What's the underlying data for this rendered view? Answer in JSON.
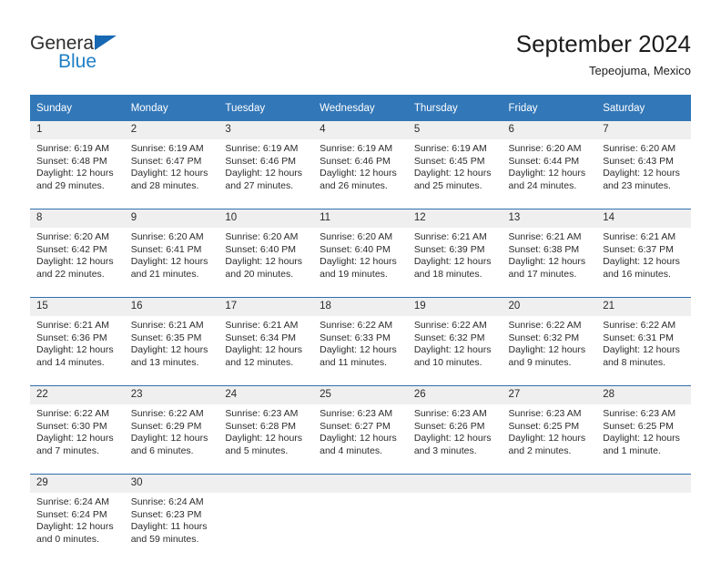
{
  "brand": {
    "name_part1": "General",
    "name_part2": "Blue",
    "accent_color": "#1f7fc6",
    "triangle_color": "#1668b3"
  },
  "header": {
    "title": "September 2024",
    "subtitle": "Tepeojuma, Mexico"
  },
  "theme": {
    "header_bg": "#3277b8",
    "day_band_bg": "#efefef",
    "separator_color": "#2f6fad"
  },
  "weekday_headers": [
    "Sunday",
    "Monday",
    "Tuesday",
    "Wednesday",
    "Thursday",
    "Friday",
    "Saturday"
  ],
  "weeks": [
    {
      "days": [
        {
          "number": "1",
          "sunrise": "Sunrise: 6:19 AM",
          "sunset": "Sunset: 6:48 PM",
          "daylight_line1": "Daylight: 12 hours",
          "daylight_line2": "and 29 minutes."
        },
        {
          "number": "2",
          "sunrise": "Sunrise: 6:19 AM",
          "sunset": "Sunset: 6:47 PM",
          "daylight_line1": "Daylight: 12 hours",
          "daylight_line2": "and 28 minutes."
        },
        {
          "number": "3",
          "sunrise": "Sunrise: 6:19 AM",
          "sunset": "Sunset: 6:46 PM",
          "daylight_line1": "Daylight: 12 hours",
          "daylight_line2": "and 27 minutes."
        },
        {
          "number": "4",
          "sunrise": "Sunrise: 6:19 AM",
          "sunset": "Sunset: 6:46 PM",
          "daylight_line1": "Daylight: 12 hours",
          "daylight_line2": "and 26 minutes."
        },
        {
          "number": "5",
          "sunrise": "Sunrise: 6:19 AM",
          "sunset": "Sunset: 6:45 PM",
          "daylight_line1": "Daylight: 12 hours",
          "daylight_line2": "and 25 minutes."
        },
        {
          "number": "6",
          "sunrise": "Sunrise: 6:20 AM",
          "sunset": "Sunset: 6:44 PM",
          "daylight_line1": "Daylight: 12 hours",
          "daylight_line2": "and 24 minutes."
        },
        {
          "number": "7",
          "sunrise": "Sunrise: 6:20 AM",
          "sunset": "Sunset: 6:43 PM",
          "daylight_line1": "Daylight: 12 hours",
          "daylight_line2": "and 23 minutes."
        }
      ]
    },
    {
      "days": [
        {
          "number": "8",
          "sunrise": "Sunrise: 6:20 AM",
          "sunset": "Sunset: 6:42 PM",
          "daylight_line1": "Daylight: 12 hours",
          "daylight_line2": "and 22 minutes."
        },
        {
          "number": "9",
          "sunrise": "Sunrise: 6:20 AM",
          "sunset": "Sunset: 6:41 PM",
          "daylight_line1": "Daylight: 12 hours",
          "daylight_line2": "and 21 minutes."
        },
        {
          "number": "10",
          "sunrise": "Sunrise: 6:20 AM",
          "sunset": "Sunset: 6:40 PM",
          "daylight_line1": "Daylight: 12 hours",
          "daylight_line2": "and 20 minutes."
        },
        {
          "number": "11",
          "sunrise": "Sunrise: 6:20 AM",
          "sunset": "Sunset: 6:40 PM",
          "daylight_line1": "Daylight: 12 hours",
          "daylight_line2": "and 19 minutes."
        },
        {
          "number": "12",
          "sunrise": "Sunrise: 6:21 AM",
          "sunset": "Sunset: 6:39 PM",
          "daylight_line1": "Daylight: 12 hours",
          "daylight_line2": "and 18 minutes."
        },
        {
          "number": "13",
          "sunrise": "Sunrise: 6:21 AM",
          "sunset": "Sunset: 6:38 PM",
          "daylight_line1": "Daylight: 12 hours",
          "daylight_line2": "and 17 minutes."
        },
        {
          "number": "14",
          "sunrise": "Sunrise: 6:21 AM",
          "sunset": "Sunset: 6:37 PM",
          "daylight_line1": "Daylight: 12 hours",
          "daylight_line2": "and 16 minutes."
        }
      ]
    },
    {
      "days": [
        {
          "number": "15",
          "sunrise": "Sunrise: 6:21 AM",
          "sunset": "Sunset: 6:36 PM",
          "daylight_line1": "Daylight: 12 hours",
          "daylight_line2": "and 14 minutes."
        },
        {
          "number": "16",
          "sunrise": "Sunrise: 6:21 AM",
          "sunset": "Sunset: 6:35 PM",
          "daylight_line1": "Daylight: 12 hours",
          "daylight_line2": "and 13 minutes."
        },
        {
          "number": "17",
          "sunrise": "Sunrise: 6:21 AM",
          "sunset": "Sunset: 6:34 PM",
          "daylight_line1": "Daylight: 12 hours",
          "daylight_line2": "and 12 minutes."
        },
        {
          "number": "18",
          "sunrise": "Sunrise: 6:22 AM",
          "sunset": "Sunset: 6:33 PM",
          "daylight_line1": "Daylight: 12 hours",
          "daylight_line2": "and 11 minutes."
        },
        {
          "number": "19",
          "sunrise": "Sunrise: 6:22 AM",
          "sunset": "Sunset: 6:32 PM",
          "daylight_line1": "Daylight: 12 hours",
          "daylight_line2": "and 10 minutes."
        },
        {
          "number": "20",
          "sunrise": "Sunrise: 6:22 AM",
          "sunset": "Sunset: 6:32 PM",
          "daylight_line1": "Daylight: 12 hours",
          "daylight_line2": "and 9 minutes."
        },
        {
          "number": "21",
          "sunrise": "Sunrise: 6:22 AM",
          "sunset": "Sunset: 6:31 PM",
          "daylight_line1": "Daylight: 12 hours",
          "daylight_line2": "and 8 minutes."
        }
      ]
    },
    {
      "days": [
        {
          "number": "22",
          "sunrise": "Sunrise: 6:22 AM",
          "sunset": "Sunset: 6:30 PM",
          "daylight_line1": "Daylight: 12 hours",
          "daylight_line2": "and 7 minutes."
        },
        {
          "number": "23",
          "sunrise": "Sunrise: 6:22 AM",
          "sunset": "Sunset: 6:29 PM",
          "daylight_line1": "Daylight: 12 hours",
          "daylight_line2": "and 6 minutes."
        },
        {
          "number": "24",
          "sunrise": "Sunrise: 6:23 AM",
          "sunset": "Sunset: 6:28 PM",
          "daylight_line1": "Daylight: 12 hours",
          "daylight_line2": "and 5 minutes."
        },
        {
          "number": "25",
          "sunrise": "Sunrise: 6:23 AM",
          "sunset": "Sunset: 6:27 PM",
          "daylight_line1": "Daylight: 12 hours",
          "daylight_line2": "and 4 minutes."
        },
        {
          "number": "26",
          "sunrise": "Sunrise: 6:23 AM",
          "sunset": "Sunset: 6:26 PM",
          "daylight_line1": "Daylight: 12 hours",
          "daylight_line2": "and 3 minutes."
        },
        {
          "number": "27",
          "sunrise": "Sunrise: 6:23 AM",
          "sunset": "Sunset: 6:25 PM",
          "daylight_line1": "Daylight: 12 hours",
          "daylight_line2": "and 2 minutes."
        },
        {
          "number": "28",
          "sunrise": "Sunrise: 6:23 AM",
          "sunset": "Sunset: 6:25 PM",
          "daylight_line1": "Daylight: 12 hours",
          "daylight_line2": "and 1 minute."
        }
      ]
    },
    {
      "days": [
        {
          "number": "29",
          "sunrise": "Sunrise: 6:24 AM",
          "sunset": "Sunset: 6:24 PM",
          "daylight_line1": "Daylight: 12 hours",
          "daylight_line2": "and 0 minutes."
        },
        {
          "number": "30",
          "sunrise": "Sunrise: 6:24 AM",
          "sunset": "Sunset: 6:23 PM",
          "daylight_line1": "Daylight: 11 hours",
          "daylight_line2": "and 59 minutes."
        },
        {
          "number": "",
          "sunrise": "",
          "sunset": "",
          "daylight_line1": "",
          "daylight_line2": ""
        },
        {
          "number": "",
          "sunrise": "",
          "sunset": "",
          "daylight_line1": "",
          "daylight_line2": ""
        },
        {
          "number": "",
          "sunrise": "",
          "sunset": "",
          "daylight_line1": "",
          "daylight_line2": ""
        },
        {
          "number": "",
          "sunrise": "",
          "sunset": "",
          "daylight_line1": "",
          "daylight_line2": ""
        },
        {
          "number": "",
          "sunrise": "",
          "sunset": "",
          "daylight_line1": "",
          "daylight_line2": ""
        }
      ]
    }
  ]
}
